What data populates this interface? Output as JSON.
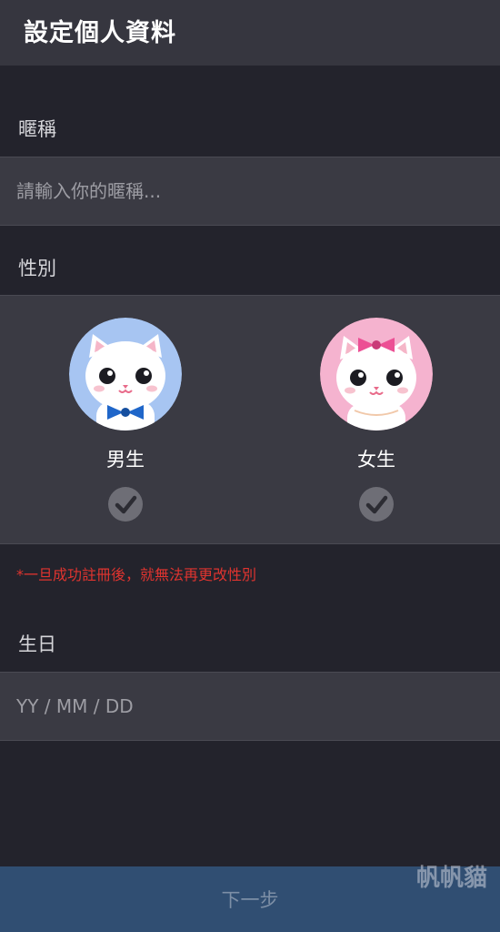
{
  "header": {
    "title": "設定個人資料"
  },
  "nickname": {
    "label": "暱稱",
    "value": "",
    "placeholder": "請輸入你的暱稱..."
  },
  "gender": {
    "label": "性別",
    "options": [
      {
        "label": "男生",
        "avatar_bg": "#a7c5f2",
        "accessory": "blue-bowtie",
        "accessory_color": "#1f66c9"
      },
      {
        "label": "女生",
        "avatar_bg": "#f5b3cf",
        "accessory": "pink-bow",
        "accessory_color": "#ec4f94"
      }
    ],
    "warning": "*一旦成功註冊後，就無法再更改性別"
  },
  "birthday": {
    "label": "生日",
    "value": "",
    "placeholder": "YY / MM / DD"
  },
  "footer": {
    "next_label": "下一步",
    "watermark": "帆帆貓"
  },
  "colors": {
    "background": "#23232c",
    "header": "#36363f",
    "field": "#3a3a43",
    "warning": "#e0342f",
    "footer": "#304e72",
    "check_circle": "#6e6e76"
  }
}
